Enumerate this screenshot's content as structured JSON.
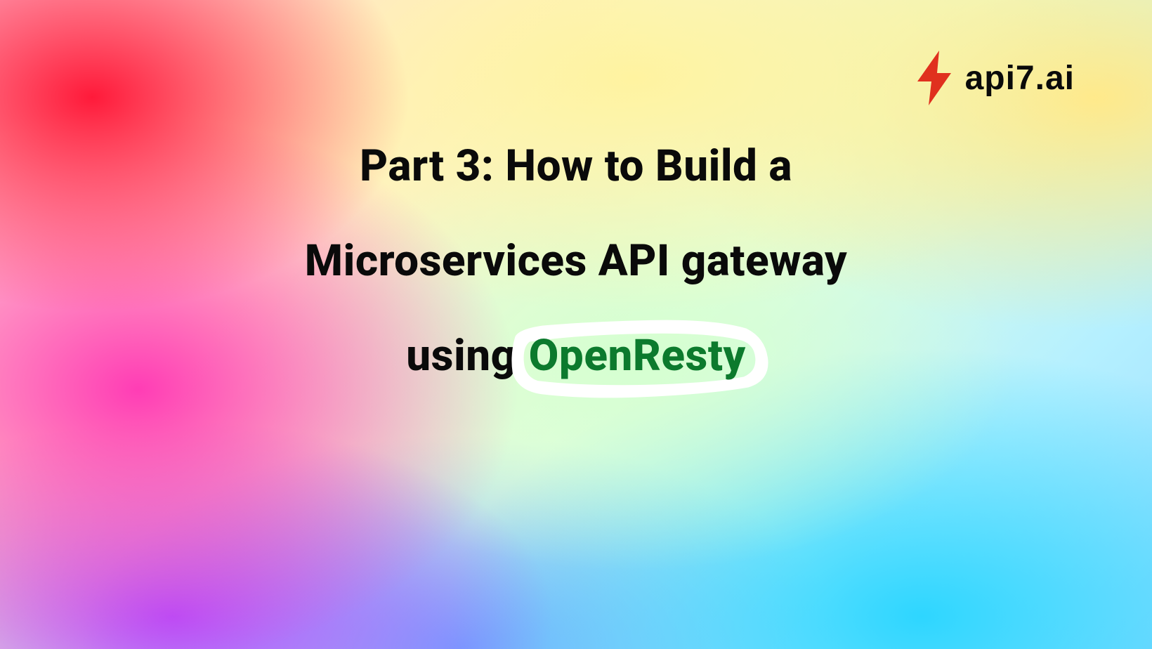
{
  "logo": {
    "text": "api7.ai"
  },
  "title": {
    "line1": "Part 3: How to Build a",
    "line2": "Microservices API gateway",
    "line3_prefix": "using",
    "line3_highlight": "OpenResty"
  }
}
